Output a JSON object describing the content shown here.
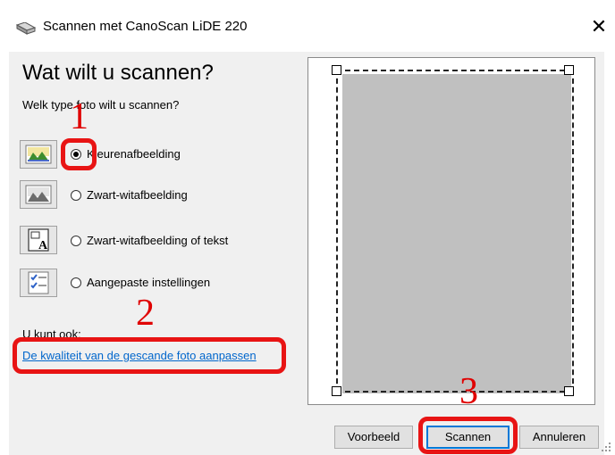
{
  "window": {
    "title": "Scannen met CanoScan LiDE 220",
    "close_glyph": "✕"
  },
  "main": {
    "heading": "Wat wilt u scannen?",
    "question": "Welk type foto wilt u scannen?",
    "options": [
      {
        "label": "Kleurenafbeelding",
        "selected": true,
        "icon": "color-photo-icon"
      },
      {
        "label": "Zwart-witafbeelding",
        "selected": false,
        "icon": "grayscale-photo-icon"
      },
      {
        "label": "Zwart-witafbeelding of tekst",
        "selected": false,
        "icon": "text-document-icon"
      },
      {
        "label": "Aangepaste instellingen",
        "selected": false,
        "icon": "custom-settings-icon"
      }
    ],
    "also_label": "U kunt ook:",
    "quality_link": "De kwaliteit van de gescande foto aanpassen"
  },
  "buttons": {
    "preview": "Voorbeeld",
    "scan": "Scannen",
    "cancel": "Annuleren"
  },
  "annotations": {
    "one": "1",
    "two": "2",
    "three": "3",
    "color": "#e81414"
  }
}
